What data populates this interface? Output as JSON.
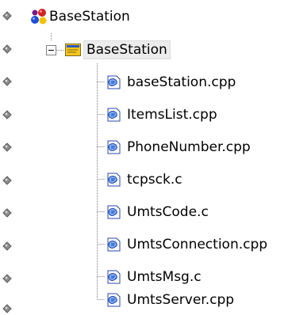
{
  "tree": {
    "root": {
      "label": "BaseStation",
      "icon": "project-workspace-icon"
    },
    "project": {
      "label": "BaseStation",
      "icon": "project-folder-icon",
      "expander": "minus"
    },
    "files": [
      {
        "label": "baseStation.cpp",
        "icon": "source-file-icon"
      },
      {
        "label": "ItemsList.cpp",
        "icon": "source-file-icon"
      },
      {
        "label": "PhoneNumber.cpp",
        "icon": "source-file-icon"
      },
      {
        "label": "tcpsck.c",
        "icon": "source-file-icon"
      },
      {
        "label": "UmtsCode.c",
        "icon": "source-file-icon"
      },
      {
        "label": "UmtsConnection.cpp",
        "icon": "source-file-icon"
      },
      {
        "label": "UmtsMsg.c",
        "icon": "source-file-icon"
      },
      {
        "label": "UmtsServer.cpp",
        "icon": "source-file-icon"
      }
    ]
  },
  "colors": {
    "selection_bg": "#ececec",
    "tree_line": "#808080",
    "folder_yellow": "#f5c51a",
    "bullet_gray": "#7a7a7a"
  }
}
